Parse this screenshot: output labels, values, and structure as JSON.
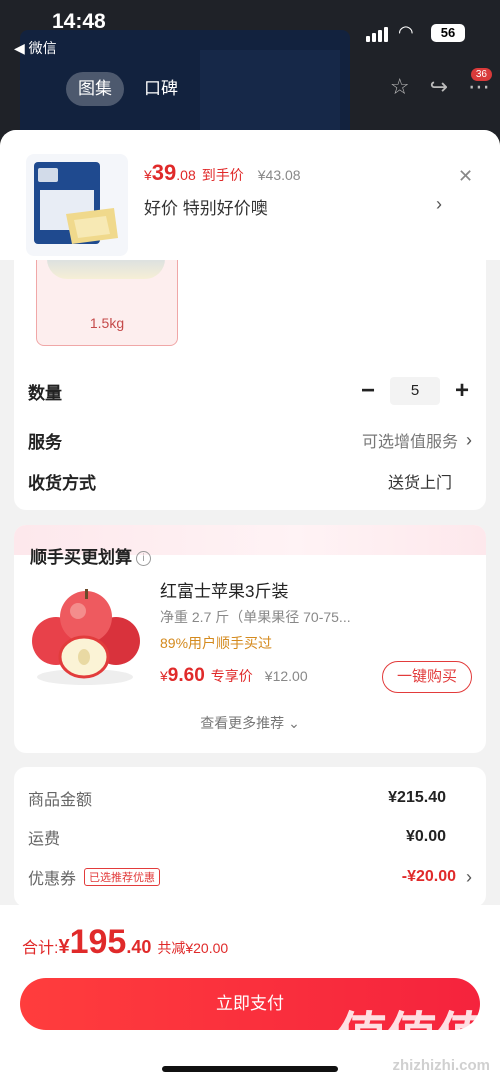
{
  "status": {
    "time": "14:48",
    "back_label": "◀ 微信",
    "battery": "56"
  },
  "gallery_tabs": [
    "图集",
    "口碑"
  ],
  "header_badge": "36",
  "product": {
    "price_currency": "¥",
    "price_int": "39",
    "price_dec": ".08",
    "price_label": "到手价",
    "orig_price": "¥43.08",
    "promo_text": "好价  特别好价噢"
  },
  "spec": {
    "selected_label": "1.5kg"
  },
  "options": {
    "qty_label": "数量",
    "qty_value": "5",
    "service_label": "服务",
    "service_value": "可选增值服务",
    "delivery_label": "收货方式",
    "delivery_value": "送货上门"
  },
  "recommend": {
    "title": "顺手买更划算",
    "info_icon": "i",
    "item": {
      "name": "红富士苹果3斤装",
      "desc": "净重 2.7 斤（单果果径 70-75...",
      "bought": "89%用户顺手买过",
      "price_currency": "¥",
      "price": "9.60",
      "price_label": "专享价",
      "orig_price": "¥12.00",
      "buy_label": "一键购买"
    },
    "more_label": "查看更多推荐 ⌄"
  },
  "totals": {
    "goods_label": "商品金额",
    "goods_value": "¥215.40",
    "shipping_label": "运费",
    "shipping_value": "¥0.00",
    "coupon_label": "优惠券",
    "coupon_tag": "已选推荐优惠",
    "coupon_value": "-¥20.00"
  },
  "footer": {
    "total_label": "合计: ",
    "currency": "¥",
    "total_int": "195",
    "total_dec": ".40",
    "saving": "共减¥20.00",
    "pay_label": "立即支付"
  },
  "watermark": {
    "main": "值值值",
    "site": "zhizhizhi.com"
  },
  "colors": {
    "accent": "#e02a2a",
    "bought": "#d48a1e"
  }
}
